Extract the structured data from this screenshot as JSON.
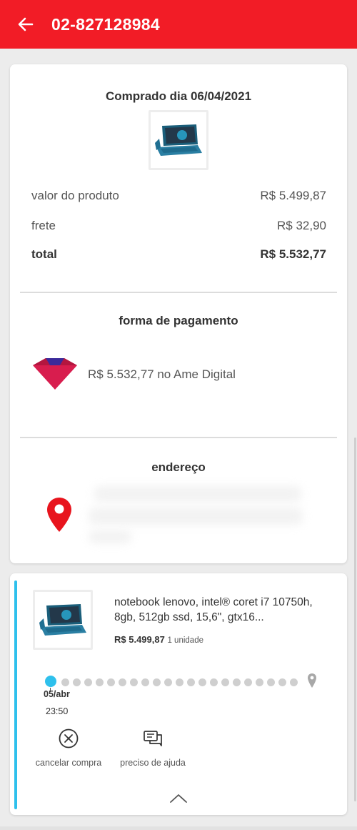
{
  "header": {
    "title": "02-827128984",
    "back_icon": "arrow-left-icon",
    "color": "#f21c26"
  },
  "summary": {
    "purchased_date": "Comprado dia 06/04/2021",
    "product_image": "laptop-thumbnail",
    "rows": [
      {
        "label": "valor do produto",
        "value": "R$ 5.499,87"
      },
      {
        "label": "frete",
        "value": "R$ 32,90"
      },
      {
        "label": "total",
        "value": "R$ 5.532,77"
      }
    ]
  },
  "payment": {
    "title": "forma de pagamento",
    "icon": "ame-digital-icon",
    "text": "R$ 5.532,77 no Ame Digital"
  },
  "address": {
    "title": "endereço",
    "icon": "location-pin-icon"
  },
  "item": {
    "name": "notebook lenovo, intel® coret i7 10750h, 8gb, 512gb ssd, 15,6\", gtx16...",
    "price": "R$ 5.499,87",
    "quantity": "1 unidade",
    "accent_color": "#2ec0ec",
    "tracking": {
      "date": "05/abr",
      "time": "23:50",
      "progress": 0
    },
    "actions": [
      {
        "label": "cancelar compra",
        "icon": "cancel-x-icon"
      },
      {
        "label": "preciso de ajuda",
        "icon": "chat-help-icon"
      }
    ],
    "collapse_icon": "chevron-up-icon"
  }
}
